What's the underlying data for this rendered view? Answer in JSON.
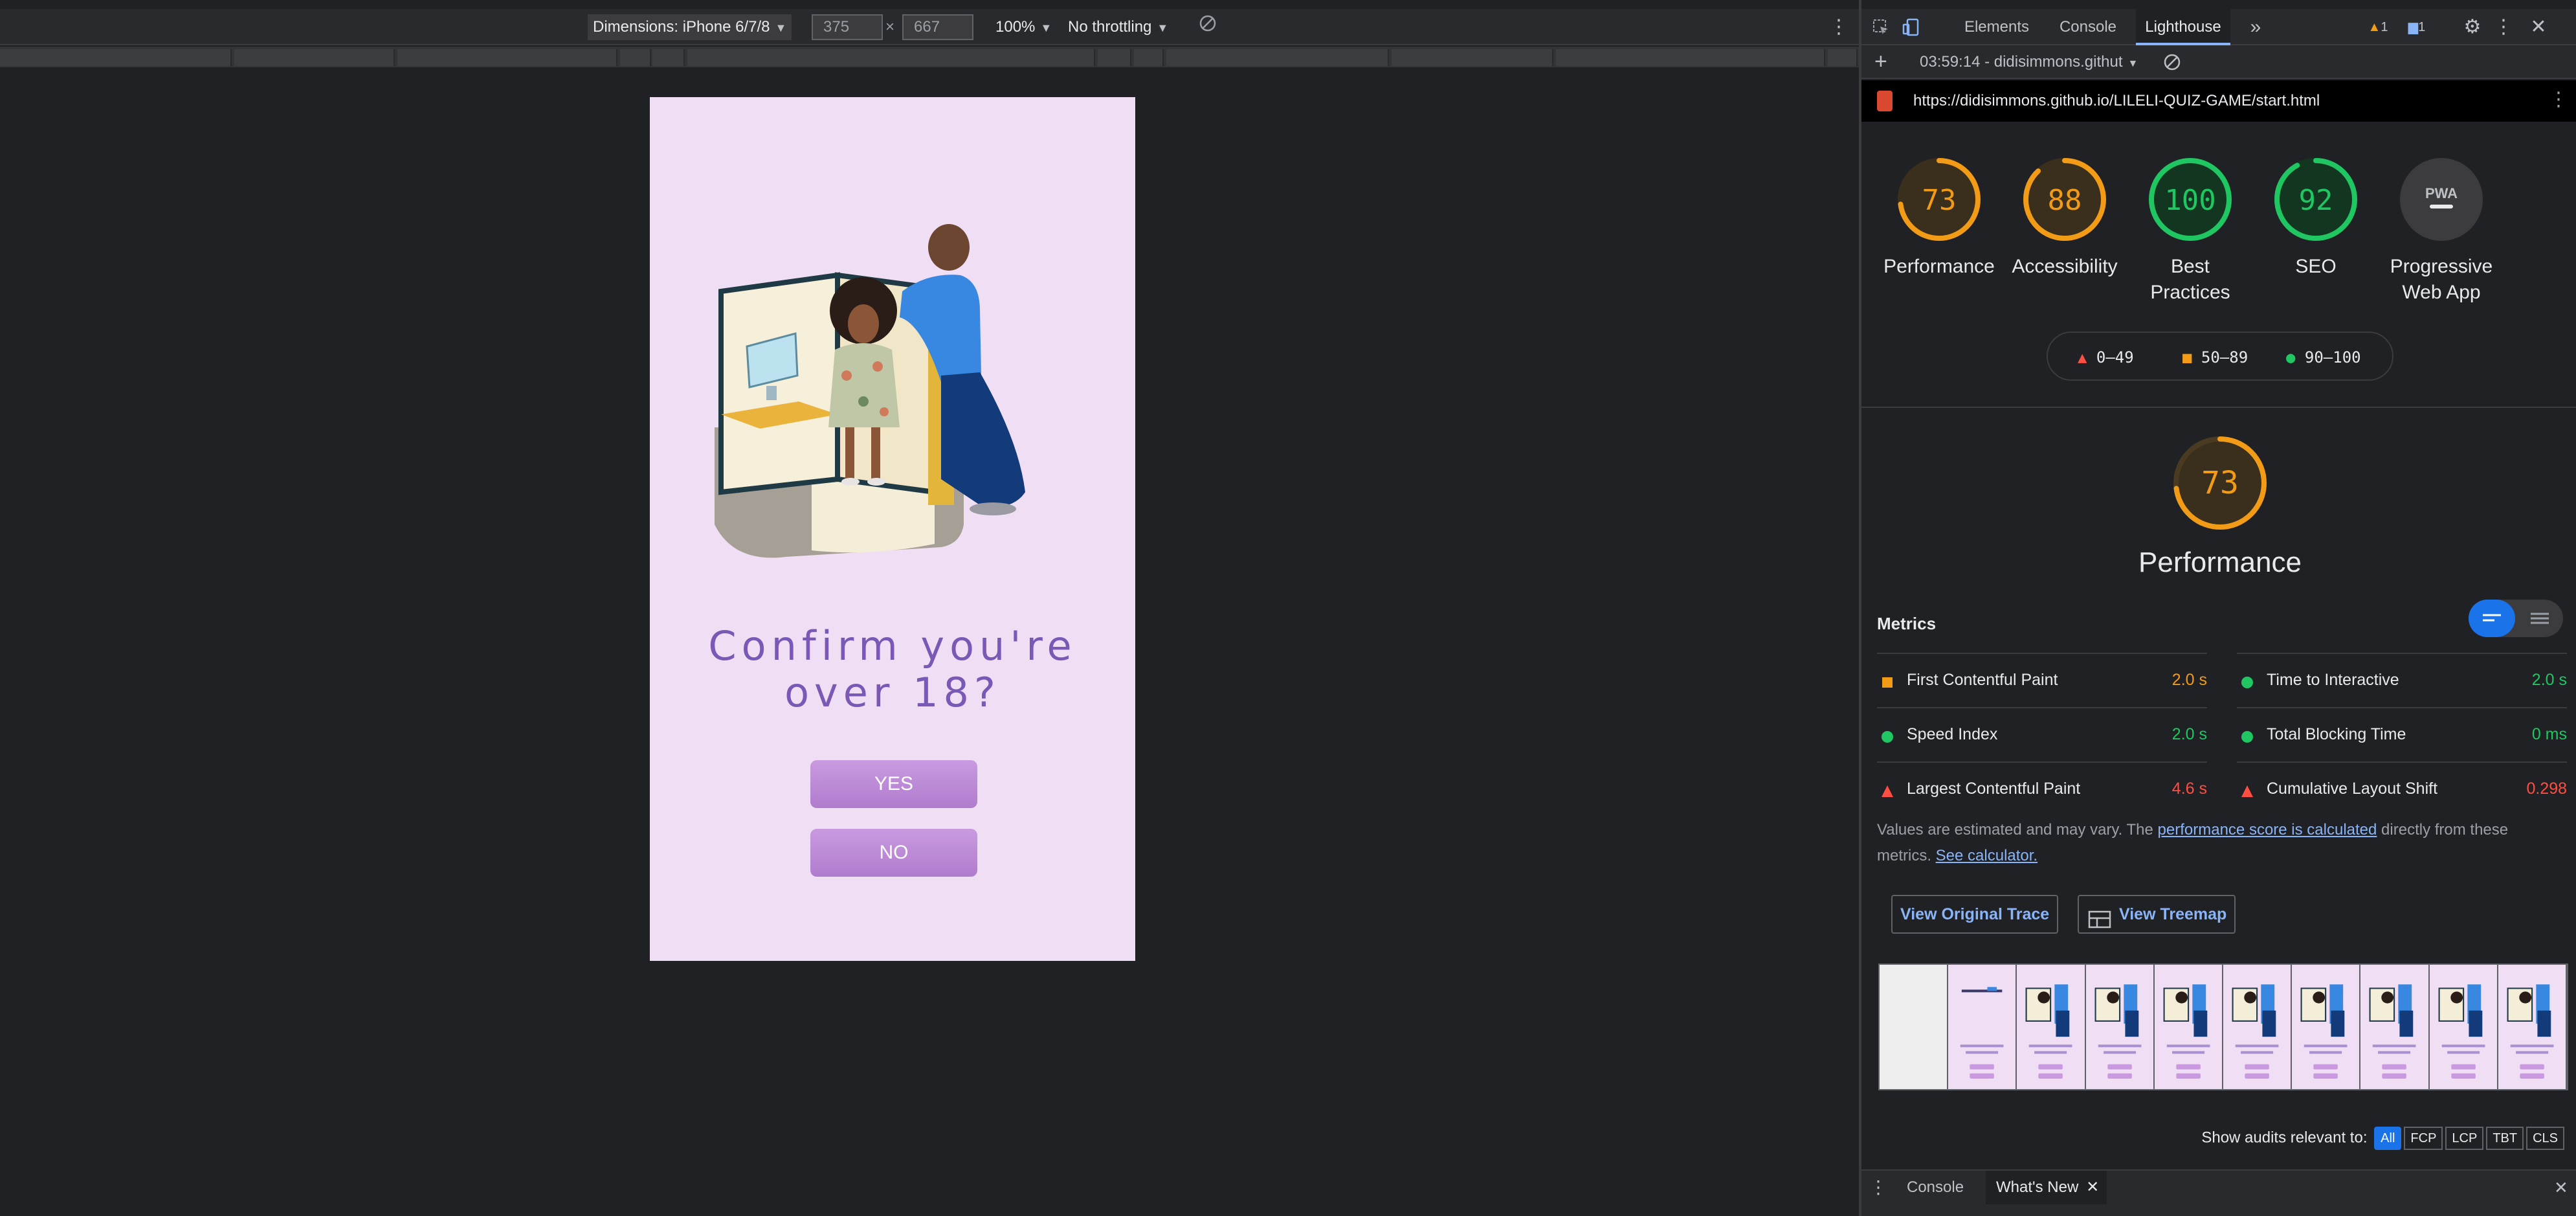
{
  "device_toolbar": {
    "dimensions_label": "Dimensions: iPhone 6/7/8",
    "width_value": "375",
    "times": "×",
    "height_value": "667",
    "zoom_label": "100%",
    "throttle_label": "No throttling"
  },
  "phone": {
    "title": "Confirm you're over 18?",
    "yes_label": "YES",
    "no_label": "NO"
  },
  "devtools": {
    "tabs": [
      "Elements",
      "Console",
      "Lighthouse"
    ],
    "active_tab": "Lighthouse",
    "more_tabs_glyph": "»",
    "warning_count": "1",
    "message_count": "1",
    "report_selector": "03:59:14 - didisimmons.githut",
    "url": "https://didisimmons.github.io/LILELI-QUIZ-GAME/start.html"
  },
  "lighthouse": {
    "scores": [
      {
        "label": "Performance",
        "value": "73",
        "color": "#f29b16"
      },
      {
        "label": "Accessibility",
        "value": "88",
        "color": "#f29b16"
      },
      {
        "label": "Best Practices",
        "value": "100",
        "color": "#1fc662"
      },
      {
        "label": "SEO",
        "value": "92",
        "color": "#1fc662"
      },
      {
        "label": "Progressive Web App",
        "value": "PWA",
        "color": "#5f6368"
      }
    ],
    "legend": {
      "fail": "0–49",
      "average": "50–89",
      "pass": "90–100"
    },
    "main_score": "73",
    "main_label": "Performance",
    "metrics_header": "Metrics",
    "metrics": [
      {
        "name": "First Contentful Paint",
        "value": "2.0 s",
        "status": "average"
      },
      {
        "name": "Time to Interactive",
        "value": "2.0 s",
        "status": "pass"
      },
      {
        "name": "Speed Index",
        "value": "2.0 s",
        "status": "pass"
      },
      {
        "name": "Total Blocking Time",
        "value": "0 ms",
        "status": "pass"
      },
      {
        "name": "Largest Contentful Paint",
        "value": "4.6 s",
        "status": "fail"
      },
      {
        "name": "Cumulative Layout Shift",
        "value": "0.298",
        "status": "fail"
      }
    ],
    "note_prefix": "Values are estimated and may vary. The ",
    "note_link1": "performance score is calculated",
    "note_middle": " directly from these metrics. ",
    "note_link2": "See calculator.",
    "view_trace": "View Original Trace",
    "view_treemap": "View Treemap",
    "relevant_label": "Show audits relevant to:",
    "filters": [
      "All",
      "FCP",
      "LCP",
      "TBT",
      "CLS"
    ],
    "colors": {
      "pass": "#1fc662",
      "average": "#f29b16",
      "fail": "#ff4e42"
    }
  },
  "drawer": {
    "tabs": [
      "Console",
      "What's New"
    ],
    "active": "What's New"
  }
}
